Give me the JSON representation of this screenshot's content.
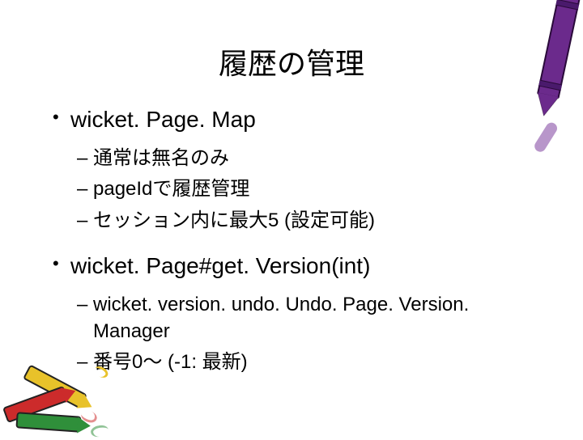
{
  "title": "履歴の管理",
  "items": {
    "0": {
      "label": "wicket. Page. Map",
      "sub": {
        "0": "通常は無名のみ",
        "1": "pageIdで履歴管理",
        "2": "セッション内に最大5 (設定可能)"
      }
    },
    "1": {
      "label": "wicket. Page#get. Version(int)",
      "sub": {
        "0": "wicket. version. undo. Undo. Page. Version. Manager",
        "1": "番号0～ (-1: 最新)"
      }
    }
  }
}
